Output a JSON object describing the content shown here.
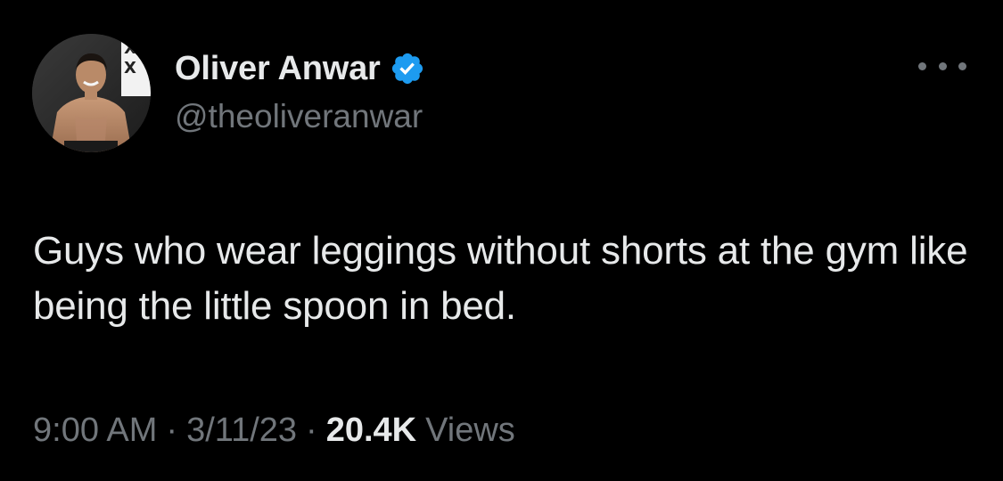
{
  "tweet": {
    "author": {
      "display_name": "Oliver Anwar",
      "handle": "@theoliveranwar",
      "verified": true,
      "avatar": "profile-photo"
    },
    "text": "Guys who wear leggings without shorts at the gym like being the little spoon in bed.",
    "time": "9:00 AM",
    "separator": "·",
    "date": "3/11/23",
    "views_count": "20.4K",
    "views_label": "Views",
    "more_icon": "ellipsis-icon"
  },
  "colors": {
    "background": "#000000",
    "primary_text": "#e7e9ea",
    "secondary_text": "#71767b",
    "verified_badge": "#1d9bf0"
  }
}
